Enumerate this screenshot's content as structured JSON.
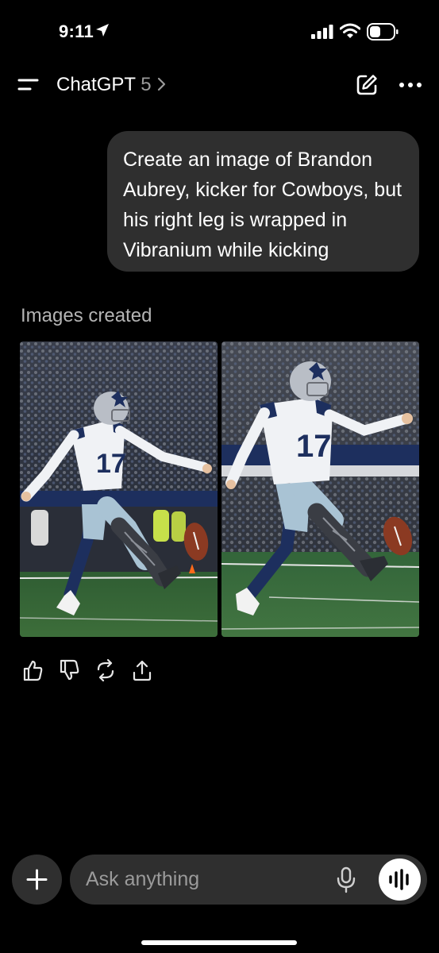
{
  "status_bar": {
    "time": "9:11"
  },
  "header": {
    "title": "ChatGPT",
    "model": "5"
  },
  "conversation": {
    "user_message": "Create an image of Brandon Aubrey, kicker for Cowboys, but his right leg is wrapped in Vibranium while kicking",
    "images_label": "Images created",
    "images": [
      {
        "jersey_number": "17"
      },
      {
        "jersey_number": "17"
      }
    ]
  },
  "composer": {
    "placeholder": "Ask anything"
  },
  "icons": {
    "status": [
      "location-arrow-icon",
      "signal-icon",
      "wifi-icon",
      "battery-icon"
    ],
    "header": [
      "menu-icon",
      "chevron-right-icon",
      "new-chat-icon",
      "more-icon"
    ],
    "actions": [
      "thumbs-up-icon",
      "thumbs-down-icon",
      "regenerate-icon",
      "share-icon"
    ],
    "composer": [
      "plus-icon",
      "mic-icon",
      "voice-mode-icon"
    ]
  },
  "colors": {
    "background": "#000000",
    "bubble": "#2f2f2f",
    "muted_text": "#9b9b9b",
    "jersey_navy": "#1d2f5e",
    "pants_blue": "#a9c3d4",
    "vibranium": "#3a3d44"
  }
}
